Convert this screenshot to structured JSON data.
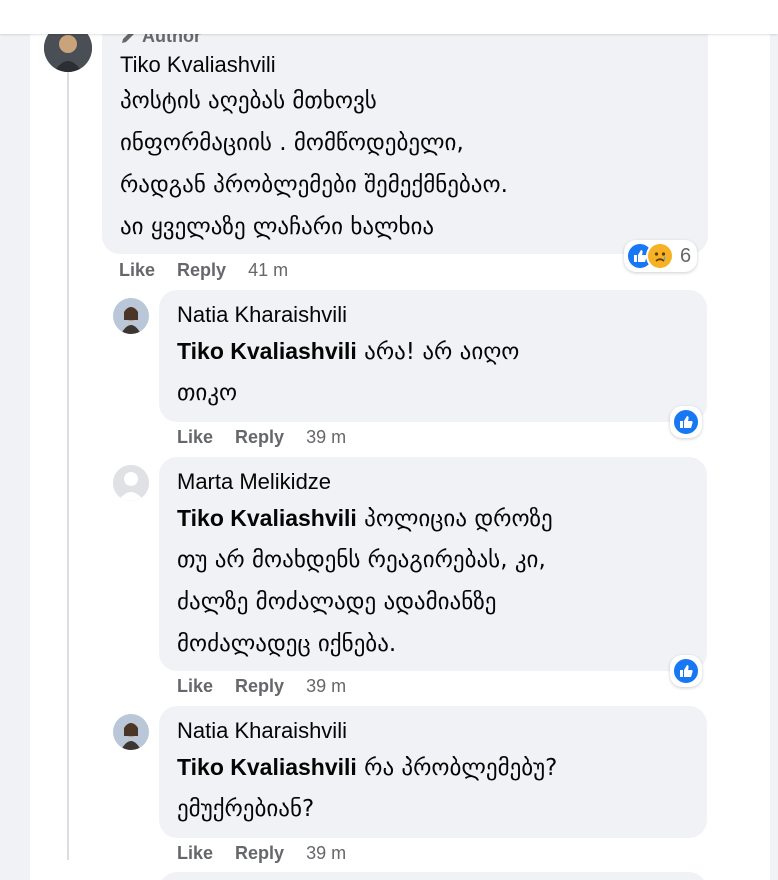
{
  "top_comment": {
    "badge": "Author",
    "name": "Tiko Kvaliashvili",
    "lines": [
      "პოსტის აღებას მთხოვს",
      "ინფორმაციის . მომწოდებელი,",
      "რადგან პრობლემები შემექმნებაო.",
      "აი ყველაზე ლაჩარი ხალხია"
    ],
    "like_label": "Like",
    "reply_label": "Reply",
    "time": "41 m",
    "reaction_count": "6"
  },
  "replies": [
    {
      "name": "Natia Kharaishvili",
      "mention": "Tiko Kvaliashvili",
      "lines": [
        "არა! არ აიღო",
        "თიკო"
      ],
      "like_label": "Like",
      "reply_label": "Reply",
      "time": "39 m"
    },
    {
      "name": "Marta Melikidze",
      "mention": "Tiko Kvaliashvili",
      "lines": [
        "პოლიცია დროზე",
        "თუ არ მოახდენს რეაგირებას, კი,",
        "ძალზე მოძალადე ადამიანზე",
        "მოძალადეც იქნება."
      ],
      "like_label": "Like",
      "reply_label": "Reply",
      "time": "39 m"
    },
    {
      "name": "Natia Kharaishvili",
      "mention": "Tiko Kvaliashvili",
      "lines": [
        "რა პრობლემებუ?",
        "ემუქრებიან?"
      ],
      "like_label": "Like",
      "reply_label": "Reply",
      "time": "39 m"
    }
  ],
  "colors": {
    "like_blue": "#1877f2",
    "bubble_bg": "#f0f2f5",
    "meta_gray": "#65676b"
  }
}
